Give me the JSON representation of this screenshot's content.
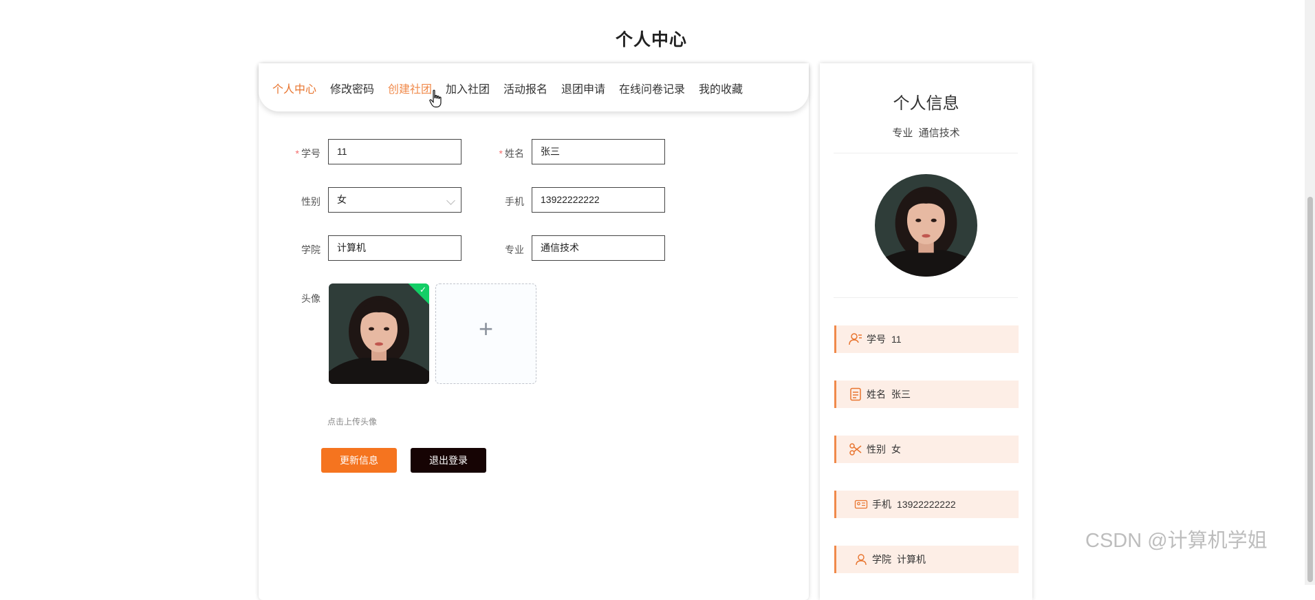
{
  "page": {
    "title": "个人中心"
  },
  "tabs": [
    {
      "label": "个人中心",
      "state": "active"
    },
    {
      "label": "修改密码",
      "state": "normal"
    },
    {
      "label": "创建社团",
      "state": "hover"
    },
    {
      "label": "加入社团",
      "state": "normal"
    },
    {
      "label": "活动报名",
      "state": "normal"
    },
    {
      "label": "退团申请",
      "state": "normal"
    },
    {
      "label": "在线问卷记录",
      "state": "normal"
    },
    {
      "label": "我的收藏",
      "state": "normal"
    }
  ],
  "form": {
    "required_mark": "*",
    "student_id": {
      "label": "学号",
      "value": "11"
    },
    "name": {
      "label": "姓名",
      "value": "张三"
    },
    "gender": {
      "label": "性别",
      "value": "女"
    },
    "phone": {
      "label": "手机",
      "value": "13922222222"
    },
    "college": {
      "label": "学院",
      "value": "计算机"
    },
    "major": {
      "label": "专业",
      "value": "通信技术"
    },
    "avatar": {
      "label": "头像",
      "hint": "点击上传头像",
      "upload_symbol": "+"
    },
    "update_button": "更新信息",
    "logout_button": "退出登录"
  },
  "profile": {
    "title": "个人信息",
    "major_label": "专业",
    "major_value": "通信技术",
    "rows": [
      {
        "icon": "user-id-icon",
        "label": "学号",
        "value": "11"
      },
      {
        "icon": "document-icon",
        "label": "姓名",
        "value": "张三"
      },
      {
        "icon": "scissors-icon",
        "label": "性别",
        "value": "女"
      },
      {
        "icon": "id-card-icon",
        "label": "手机",
        "value": "13922222222"
      },
      {
        "icon": "person-icon",
        "label": "学院",
        "value": "计算机"
      }
    ]
  },
  "colors": {
    "accent": "#e8742e",
    "update_button": "#f5741f",
    "logout_button": "#160404",
    "info_row_bg": "#fdeee6"
  },
  "watermark": "CSDN @计算机学姐"
}
